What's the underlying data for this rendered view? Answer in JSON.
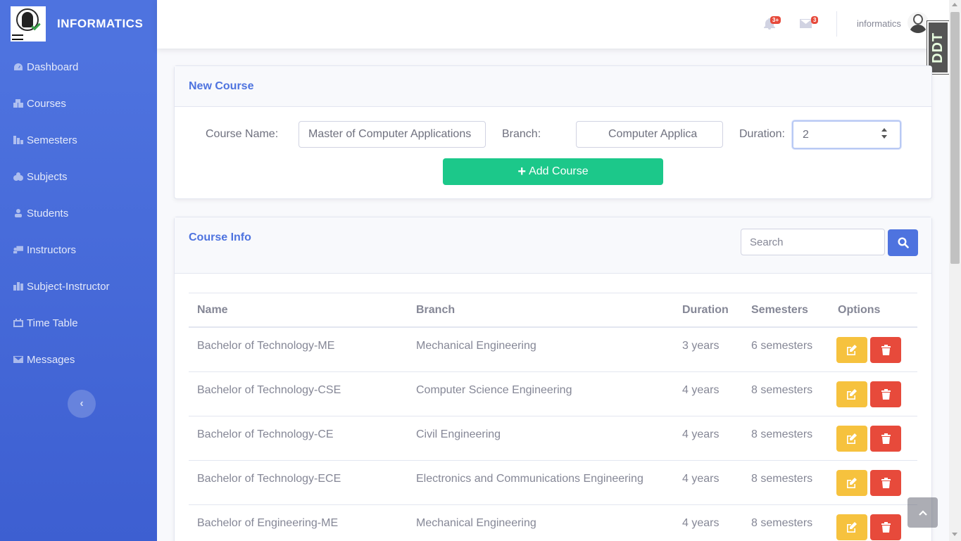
{
  "brand": {
    "name": "INFORMATICS"
  },
  "sidebar": {
    "items": [
      {
        "label": "Dashboard",
        "icon": "dashboard-icon"
      },
      {
        "label": "Courses",
        "icon": "courses-icon"
      },
      {
        "label": "Semesters",
        "icon": "semesters-icon"
      },
      {
        "label": "Subjects",
        "icon": "subjects-icon"
      },
      {
        "label": "Students",
        "icon": "students-icon"
      },
      {
        "label": "Instructors",
        "icon": "instructors-icon"
      },
      {
        "label": "Subject-Instructor",
        "icon": "subject-instructor-icon"
      },
      {
        "label": "Time Table",
        "icon": "calendar-icon"
      },
      {
        "label": "Messages",
        "icon": "envelope-icon"
      }
    ],
    "toggle_glyph": "‹"
  },
  "topbar": {
    "alerts_badge": "3+",
    "messages_badge": "3",
    "username": "informatics",
    "watermark": "DDT"
  },
  "new_course": {
    "title": "New Course",
    "course_name_label": "Course Name:",
    "course_name_value": "Master of Computer Applications",
    "branch_label": "Branch:",
    "branch_value": "Computer Applica",
    "duration_label": "Duration:",
    "duration_value": "2",
    "add_button_label": "Add Course"
  },
  "course_info": {
    "title": "Course Info",
    "search_placeholder": "Search",
    "columns": [
      "Name",
      "Branch",
      "Duration",
      "Semesters",
      "Options"
    ],
    "rows": [
      {
        "name": "Bachelor of Technology-ME",
        "branch": "Mechanical Engineering",
        "duration": "3 years",
        "semesters": "6 semesters"
      },
      {
        "name": "Bachelor of Technology-CSE",
        "branch": "Computer Science Engineering",
        "duration": "4 years",
        "semesters": "8 semesters"
      },
      {
        "name": "Bachelor of Technology-CE",
        "branch": "Civil Engineering",
        "duration": "4 years",
        "semesters": "8 semesters"
      },
      {
        "name": "Bachelor of Technology-ECE",
        "branch": "Electronics and Communications Engineering",
        "duration": "4 years",
        "semesters": "8 semesters"
      },
      {
        "name": "Bachelor of Engineering-ME",
        "branch": "Mechanical Engineering",
        "duration": "4 years",
        "semesters": "8 semesters"
      }
    ]
  },
  "colors": {
    "primary": "#4e73df",
    "success": "#1cc88a",
    "warning": "#f6c23e",
    "danger": "#e74a3b"
  }
}
